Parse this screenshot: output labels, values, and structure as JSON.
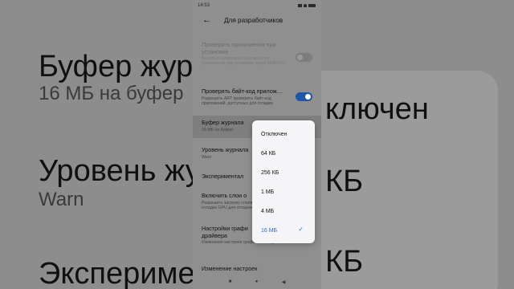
{
  "background": {
    "line1": "Буфер журнал",
    "line2": "16 МБ на буфер",
    "line3": "Уровень журн",
    "line4": "Warn",
    "line5": "Эксперимент",
    "right1": "ключен",
    "right2": "КБ",
    "right3": "КБ"
  },
  "status_bar": {
    "time": "14:53"
  },
  "header": {
    "title": "Для разработчиков"
  },
  "settings": [
    {
      "title": "Проверять приложения при установке",
      "subtitle": "Выполнять проверку безопасности приложений при установке через ADB/ADT"
    },
    {
      "title": "Проверять байт-код прилож…",
      "subtitle": "Разрешить ART проверять байт-код приложений, доступных для отладки"
    },
    {
      "title": "Буфер журнала",
      "subtitle": "16 МБ на буфер"
    },
    {
      "title": "Уровень журнала",
      "subtitle": "Warn"
    },
    {
      "title": "Экспериментал",
      "subtitle": ""
    },
    {
      "title": "Включить слои о",
      "subtitle": "Разрешить загрузку слоев отладки GPU для отладчика"
    },
    {
      "title": "Настройки графи драйвера",
      "subtitle": "Изменение настроек графического драйвера"
    },
    {
      "title": "Изменение настроек",
      "subtitle": ""
    }
  ],
  "popup": {
    "options": [
      "Отключен",
      "64 КБ",
      "256 КБ",
      "1 МБ",
      "4 МБ",
      "16 МБ"
    ],
    "selected_index": 5
  },
  "colors": {
    "accent": "#1a73e8",
    "toggle_on": "#1f55a8"
  }
}
